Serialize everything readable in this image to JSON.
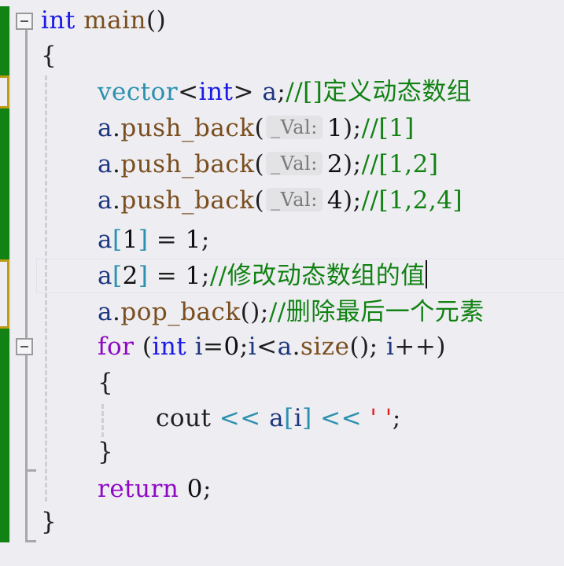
{
  "editor": {
    "lines": [
      {
        "tokens": [
          {
            "t": "int",
            "c": "kw"
          },
          {
            "t": " ",
            "c": "pun"
          },
          {
            "t": "main",
            "c": "fn"
          },
          {
            "t": "()",
            "c": "pun"
          }
        ]
      },
      {
        "tokens": [
          {
            "t": "{",
            "c": "pun"
          }
        ]
      },
      {
        "tokens": [
          {
            "t": "vector",
            "c": "type"
          },
          {
            "t": "<",
            "c": "pun"
          },
          {
            "t": "int",
            "c": "kw"
          },
          {
            "t": ">",
            "c": "pun"
          },
          {
            "t": " a",
            "c": "var"
          },
          {
            "t": ";",
            "c": "pun"
          },
          {
            "t": "//[]定义动态数组",
            "c": "cm"
          }
        ]
      },
      {
        "tokens": [
          {
            "t": "a",
            "c": "var"
          },
          {
            "t": ".",
            "c": "pun"
          },
          {
            "t": "push_back",
            "c": "fn"
          },
          {
            "t": "(",
            "c": "pun"
          },
          {
            "t": "_Val:",
            "c": "hint"
          },
          {
            "t": "1",
            "c": "num"
          },
          {
            "t": ");",
            "c": "pun"
          },
          {
            "t": "//[1]",
            "c": "cm"
          }
        ]
      },
      {
        "tokens": [
          {
            "t": "a",
            "c": "var"
          },
          {
            "t": ".",
            "c": "pun"
          },
          {
            "t": "push_back",
            "c": "fn"
          },
          {
            "t": "(",
            "c": "pun"
          },
          {
            "t": "_Val:",
            "c": "hint"
          },
          {
            "t": "2",
            "c": "num"
          },
          {
            "t": ");",
            "c": "pun"
          },
          {
            "t": "//[1,2]",
            "c": "cm"
          }
        ]
      },
      {
        "tokens": [
          {
            "t": "a",
            "c": "var"
          },
          {
            "t": ".",
            "c": "pun"
          },
          {
            "t": "push_back",
            "c": "fn"
          },
          {
            "t": "(",
            "c": "pun"
          },
          {
            "t": "_Val:",
            "c": "hint"
          },
          {
            "t": "4",
            "c": "num"
          },
          {
            "t": ");",
            "c": "pun"
          },
          {
            "t": "//[1,2,4]",
            "c": "cm"
          }
        ]
      },
      {
        "tokens": [
          {
            "t": "a",
            "c": "var"
          },
          {
            "t": "[",
            "c": "op"
          },
          {
            "t": "1",
            "c": "num"
          },
          {
            "t": "]",
            "c": "op"
          },
          {
            "t": " = ",
            "c": "pun"
          },
          {
            "t": "1",
            "c": "num"
          },
          {
            "t": ";",
            "c": "pun"
          }
        ]
      },
      {
        "tokens": [
          {
            "t": "a",
            "c": "var"
          },
          {
            "t": "[",
            "c": "op"
          },
          {
            "t": "2",
            "c": "num"
          },
          {
            "t": "]",
            "c": "op"
          },
          {
            "t": " = ",
            "c": "pun"
          },
          {
            "t": "1",
            "c": "num"
          },
          {
            "t": ";",
            "c": "pun"
          },
          {
            "t": "//修改动态数组的值",
            "c": "cm"
          },
          {
            "t": "",
            "c": "cursor"
          }
        ]
      },
      {
        "tokens": [
          {
            "t": "a",
            "c": "var"
          },
          {
            "t": ".",
            "c": "pun"
          },
          {
            "t": "pop_back",
            "c": "fn"
          },
          {
            "t": "();",
            "c": "pun"
          },
          {
            "t": "//删除最后一个元素",
            "c": "cm"
          }
        ]
      },
      {
        "tokens": [
          {
            "t": "for",
            "c": "ctrl"
          },
          {
            "t": " (",
            "c": "pun"
          },
          {
            "t": "int",
            "c": "kw"
          },
          {
            "t": " i",
            "c": "var"
          },
          {
            "t": "=",
            "c": "pun"
          },
          {
            "t": "0",
            "c": "num"
          },
          {
            "t": ";",
            "c": "pun"
          },
          {
            "t": "i",
            "c": "var"
          },
          {
            "t": "<",
            "c": "pun"
          },
          {
            "t": "a",
            "c": "var"
          },
          {
            "t": ".",
            "c": "pun"
          },
          {
            "t": "size",
            "c": "fn"
          },
          {
            "t": "(); ",
            "c": "pun"
          },
          {
            "t": "i",
            "c": "var"
          },
          {
            "t": "++)",
            "c": "pun"
          }
        ]
      },
      {
        "tokens": [
          {
            "t": "{",
            "c": "pun"
          }
        ]
      },
      {
        "tokens": [
          {
            "t": "cout",
            "c": "pun"
          },
          {
            "t": " << ",
            "c": "op"
          },
          {
            "t": "a",
            "c": "var"
          },
          {
            "t": "[",
            "c": "op"
          },
          {
            "t": "i",
            "c": "var"
          },
          {
            "t": "]",
            "c": "op"
          },
          {
            "t": " << ",
            "c": "op"
          },
          {
            "t": "' '",
            "c": "str"
          },
          {
            "t": ";",
            "c": "pun"
          }
        ]
      },
      {
        "tokens": [
          {
            "t": "}",
            "c": "pun"
          }
        ]
      },
      {
        "tokens": [
          {
            "t": "return",
            "c": "ctrl"
          },
          {
            "t": " 0",
            "c": "num"
          },
          {
            "t": ";",
            "c": "pun"
          }
        ]
      },
      {
        "tokens": [
          {
            "t": "}",
            "c": "pun"
          }
        ]
      }
    ]
  }
}
